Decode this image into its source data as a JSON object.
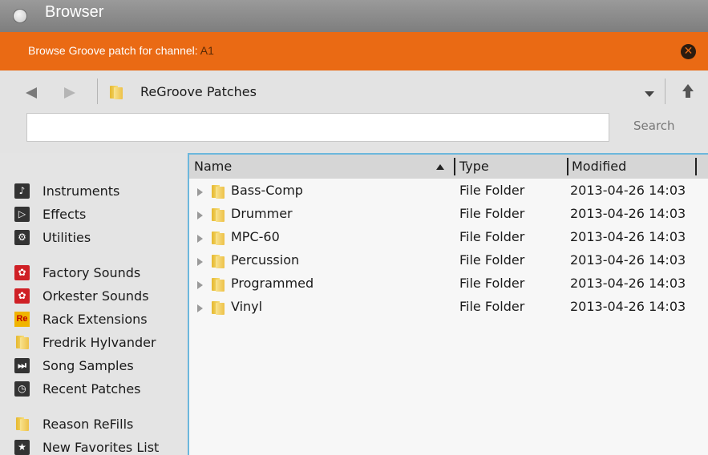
{
  "window": {
    "title": "Browser"
  },
  "banner": {
    "label": "Browse Groove patch for channel: ",
    "channel": "A1",
    "close_icon": "close-icon"
  },
  "toolbar": {
    "path_label": "ReGroove Patches",
    "search": {
      "value": "",
      "placeholder": ""
    },
    "search_button": "Search"
  },
  "sidebar": {
    "items": [
      {
        "label": "Instruments",
        "icon": "instruments-icon"
      },
      {
        "label": "Effects",
        "icon": "effects-icon"
      },
      {
        "label": "Utilities",
        "icon": "utilities-icon"
      },
      {
        "label": "Factory Sounds",
        "icon": "refill-red-icon"
      },
      {
        "label": "Orkester Sounds",
        "icon": "refill-red-icon"
      },
      {
        "label": "Rack Extensions",
        "icon": "re-icon",
        "icon_text": "Re"
      },
      {
        "label": "Fredrik Hylvander",
        "icon": "user-folder-icon"
      },
      {
        "label": "Song Samples",
        "icon": "song-samples-icon"
      },
      {
        "label": "Recent Patches",
        "icon": "recent-icon"
      },
      {
        "label": "Reason ReFills",
        "icon": "folder-icon"
      },
      {
        "label": "New Favorites List",
        "icon": "star-icon"
      }
    ]
  },
  "table": {
    "headers": {
      "name": "Name",
      "type": "Type",
      "modified": "Modified"
    },
    "sort": "name-ascending",
    "rows": [
      {
        "name": "Bass-Comp",
        "type": "File Folder",
        "modified": "2013-04-26 14:03"
      },
      {
        "name": "Drummer",
        "type": "File Folder",
        "modified": "2013-04-26 14:03"
      },
      {
        "name": "MPC-60",
        "type": "File Folder",
        "modified": "2013-04-26 14:03"
      },
      {
        "name": "Percussion",
        "type": "File Folder",
        "modified": "2013-04-26 14:03"
      },
      {
        "name": "Programmed",
        "type": "File Folder",
        "modified": "2013-04-26 14:03"
      },
      {
        "name": "Vinyl",
        "type": "File Folder",
        "modified": "2013-04-26 14:03"
      }
    ]
  },
  "colors": {
    "accent": "#ea6a14",
    "selection_border": "#6cb7dc",
    "titlebar": "#8c8c8c"
  }
}
